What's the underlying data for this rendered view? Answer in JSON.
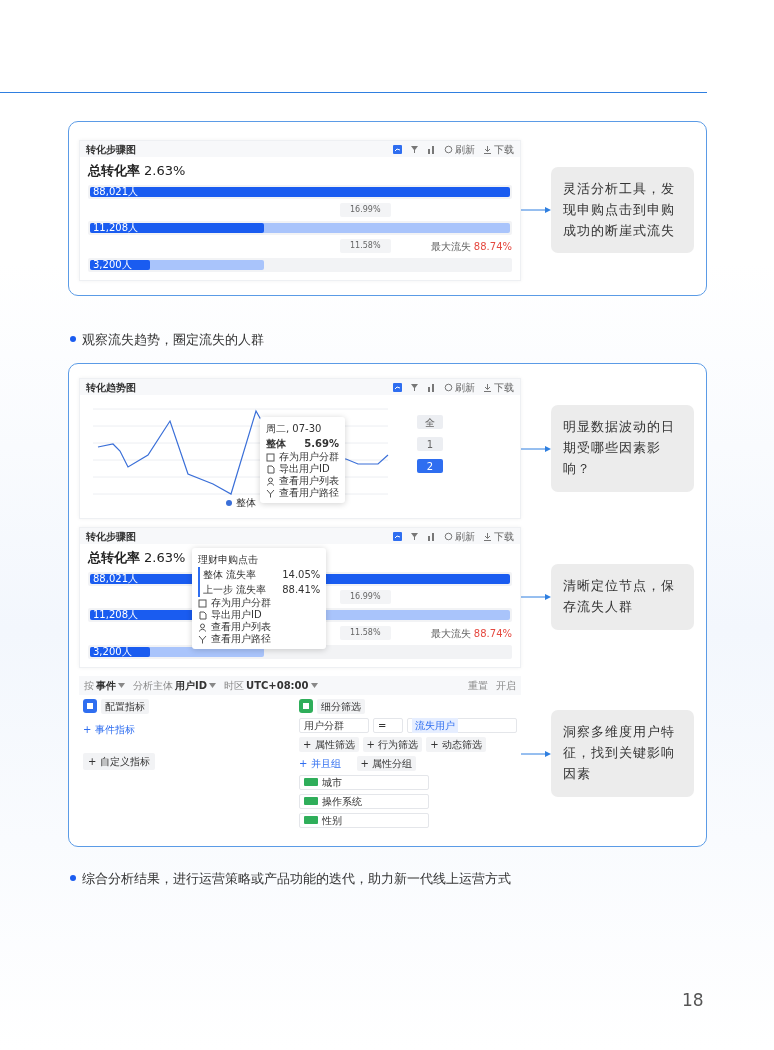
{
  "top_panel": {
    "funnel_card": {
      "title": "转化步骤图",
      "actions": [
        "刷新",
        "下载"
      ],
      "total_label": "总转化率",
      "total_value": "2.63%",
      "steps": [
        {
          "count": "88,021人",
          "bar": {
            "level": 1
          }
        },
        {
          "rate": "16.99%",
          "count": "11,208人",
          "bar": {
            "level": 0.415
          },
          "prev_bar": {
            "level": 1
          }
        },
        {
          "rate": "11.58%",
          "count": "3,200人",
          "bar": {
            "level": 0.143
          },
          "prev_bar": {
            "level": 0.415
          },
          "max_loss": {
            "label": "最大流失",
            "value": "88.74%"
          }
        }
      ]
    },
    "callout": "灵活分析工具，发现申购点击到申购成功的断崖式流失"
  },
  "bullet_1": "观察流失趋势，圈定流失的人群",
  "main_panel": {
    "trend_card": {
      "title": "转化趋势图",
      "actions": [
        "刷新",
        "下载"
      ],
      "legend": "整体",
      "steps": [
        {
          "chip": "全",
          "selected": false
        },
        {
          "chip": "1",
          "selected": false
        },
        {
          "chip": "2",
          "selected": true
        }
      ],
      "tooltip": {
        "date": "周二, 07-30",
        "series": "整体",
        "value": "5.69%",
        "menu": [
          "存为用户分群",
          "导出用户ID",
          "查看用户列表",
          "查看用户路径"
        ]
      },
      "callout": "明显数据波动的日期受哪些因素影响？"
    },
    "funnel_card": {
      "title": "转化步骤图",
      "actions": [
        "刷新",
        "下载"
      ],
      "total_label": "总转化率",
      "total_value": "2.63%",
      "steps": [
        {
          "count": "88,021人",
          "bar": {
            "level": 1
          }
        },
        {
          "rate": "16.99%",
          "count": "11,208人",
          "bar": {
            "level": 0.415
          },
          "prev_bar": {
            "level": 1
          }
        },
        {
          "rate": "11.58%",
          "count": "3,200人",
          "bar": {
            "level": 0.143
          },
          "prev_bar": {
            "level": 0.415
          },
          "max_loss": {
            "label": "最大流失",
            "value": "88.74%"
          }
        }
      ],
      "tooltip": {
        "title": "理财申购点击",
        "rows": [
          {
            "label": "整体 流失率",
            "value": "14.05%"
          },
          {
            "label": "上一步 流失率",
            "value": "88.41%"
          }
        ],
        "menu": [
          "存为用户分群",
          "导出用户ID",
          "查看用户列表",
          "查看用户路径"
        ]
      },
      "callout": "清晰定位节点，保存流失人群"
    },
    "config": {
      "toolbar": [
        {
          "label": "按",
          "value": "事件"
        },
        {
          "label": "分析主体",
          "value": "用户ID"
        },
        {
          "label": "时区",
          "value": "UTC+08:00"
        }
      ],
      "toolbar_actions": [
        "重置",
        "开启"
      ],
      "left": {
        "header": "配置指标",
        "add_link": "+ 事件指标",
        "add_button": "+ 自定义指标"
      },
      "right": {
        "header": "细分筛选",
        "select": "用户分群",
        "operator": "=",
        "tag": "流失用户",
        "filters": [
          "+ 属性筛选",
          "+ 行为筛选",
          "+ 动态筛选"
        ],
        "and_link": "+ 并且组",
        "group_button": "+ 属性分组",
        "groups": [
          "城市",
          "操作系统",
          "性别"
        ]
      },
      "callout": "洞察多维度用户特征，找到关键影响因素"
    }
  },
  "bullet_2": "综合分析结果，进行运营策略或产品功能的迭代，助力新一代线上运营方式",
  "page_number": "18"
}
